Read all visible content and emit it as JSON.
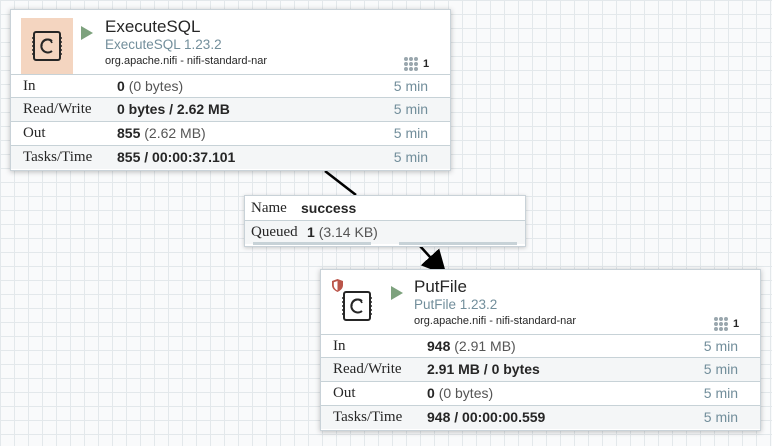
{
  "processors": {
    "execute_sql": {
      "name": "ExecuteSQL",
      "type": "ExecuteSQL 1.23.2",
      "bundle": "org.apache.nifi - nifi-standard-nar",
      "active_tasks": "1",
      "state": "running",
      "stats": {
        "in": {
          "label": "In",
          "value": "0",
          "detail": "(0 bytes)",
          "window": "5 min"
        },
        "rw": {
          "label": "Read/Write",
          "value": "0 bytes / 2.62 MB",
          "detail": "",
          "window": "5 min"
        },
        "out": {
          "label": "Out",
          "value": "855",
          "detail": "(2.62 MB)",
          "window": "5 min"
        },
        "tasks": {
          "label": "Tasks/Time",
          "value": "855 / 00:00:37.101",
          "detail": "",
          "window": "5 min"
        }
      }
    },
    "put_file": {
      "name": "PutFile",
      "type": "PutFile 1.23.2",
      "bundle": "org.apache.nifi - nifi-standard-nar",
      "active_tasks": "1",
      "state": "running",
      "stats": {
        "in": {
          "label": "In",
          "value": "948",
          "detail": "(2.91 MB)",
          "window": "5 min"
        },
        "rw": {
          "label": "Read/Write",
          "value": "2.91 MB / 0 bytes",
          "detail": "",
          "window": "5 min"
        },
        "out": {
          "label": "Out",
          "value": "0",
          "detail": "(0 bytes)",
          "window": "5 min"
        },
        "tasks": {
          "label": "Tasks/Time",
          "value": "948 / 00:00:00.559",
          "detail": "",
          "window": "5 min"
        }
      }
    }
  },
  "connection": {
    "name_label": "Name",
    "name": "success",
    "queued_label": "Queued",
    "queued_count": "1",
    "queued_size": "(3.14 KB)"
  },
  "icons": {
    "processor": "processor-icon",
    "run": "run-state-icon",
    "threads": "active-threads-icon",
    "restricted": "restricted-shield-icon"
  },
  "colors": {
    "running": "#7da27d",
    "icon_bg_active": "#f4d5c0",
    "muted": "#728e9b",
    "border": "#c9d2d8"
  }
}
